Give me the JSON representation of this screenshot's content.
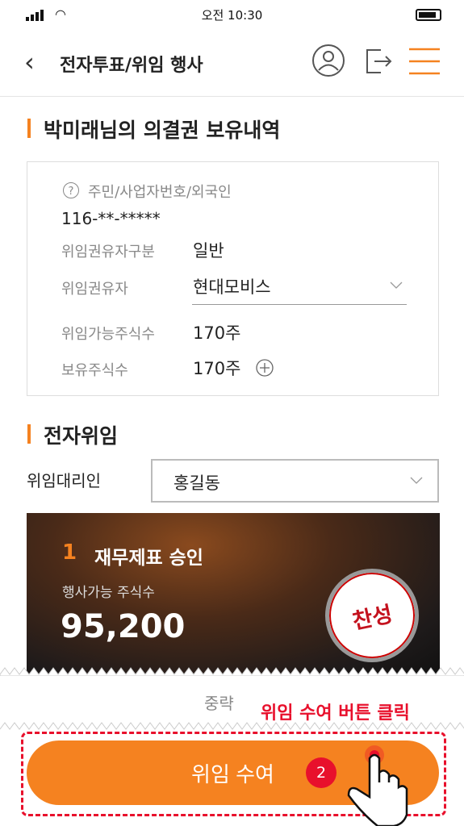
{
  "status": {
    "time": "오전 10:30"
  },
  "header": {
    "title": "전자투표/위임 행사"
  },
  "holdings": {
    "title": "박미래님의 의결권 보유내역",
    "id_label": "주민/사업자번호/외국인",
    "id_value": "116-**-*****",
    "rows": [
      {
        "label": "위임권유자구분",
        "value": "일반"
      },
      {
        "label": "위임권유자",
        "value": "현대모비스"
      },
      {
        "label": "위임가능주식수",
        "value": "170주"
      },
      {
        "label": "보유주식수",
        "value": "170주"
      }
    ]
  },
  "proxy": {
    "title": "전자위임",
    "agent_label": "위임대리인",
    "agent_value": "홍길동"
  },
  "agenda": {
    "number": "1",
    "title": "재무제표 승인",
    "shares_label": "행사가능 주식수",
    "shares_value": "95,200",
    "vote": "찬성"
  },
  "omitted": "중략",
  "annotation": {
    "hint": "위임 수여 버튼 클릭",
    "step": "2"
  },
  "submit_label": "위임 수여",
  "colors": {
    "accent": "#f58220",
    "highlight": "#e8102c"
  }
}
